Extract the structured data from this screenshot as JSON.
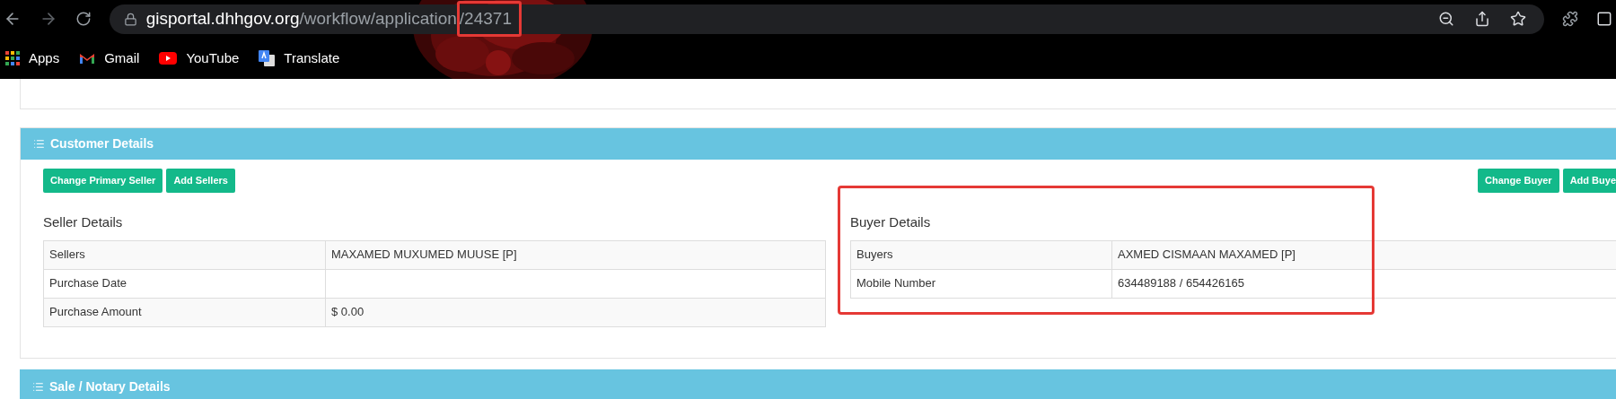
{
  "browser": {
    "url": {
      "host": "gisportal.dhhgov.org",
      "path": "/workflow/application",
      "id": "/24371"
    },
    "bookmarks": [
      {
        "label": "Apps",
        "kind": "apps"
      },
      {
        "label": "Gmail",
        "kind": "gmail"
      },
      {
        "label": "YouTube",
        "kind": "youtube"
      },
      {
        "label": "Translate",
        "kind": "translate"
      }
    ]
  },
  "sections": [
    {
      "title": "Customer Details",
      "seller": {
        "buttons": [
          "Change Primary Seller",
          "Add Sellers"
        ],
        "heading": "Seller Details",
        "rows": [
          {
            "label": "Sellers",
            "value": "MAXAMED MUXUMED MUUSE [P]"
          },
          {
            "label": "Purchase Date",
            "value": ""
          },
          {
            "label": "Purchase Amount",
            "value": "$ 0.00"
          }
        ]
      },
      "buyer": {
        "buttons": [
          "Change Buyer",
          "Add Buye"
        ],
        "heading": "Buyer Details",
        "rows": [
          {
            "label": "Buyers",
            "value": "AXMED CISMAAN MAXAMED [P]"
          },
          {
            "label": "Mobile Number",
            "value": "634489188 / 654426165"
          }
        ]
      }
    },
    {
      "title": "Sale / Notary Details"
    }
  ]
}
